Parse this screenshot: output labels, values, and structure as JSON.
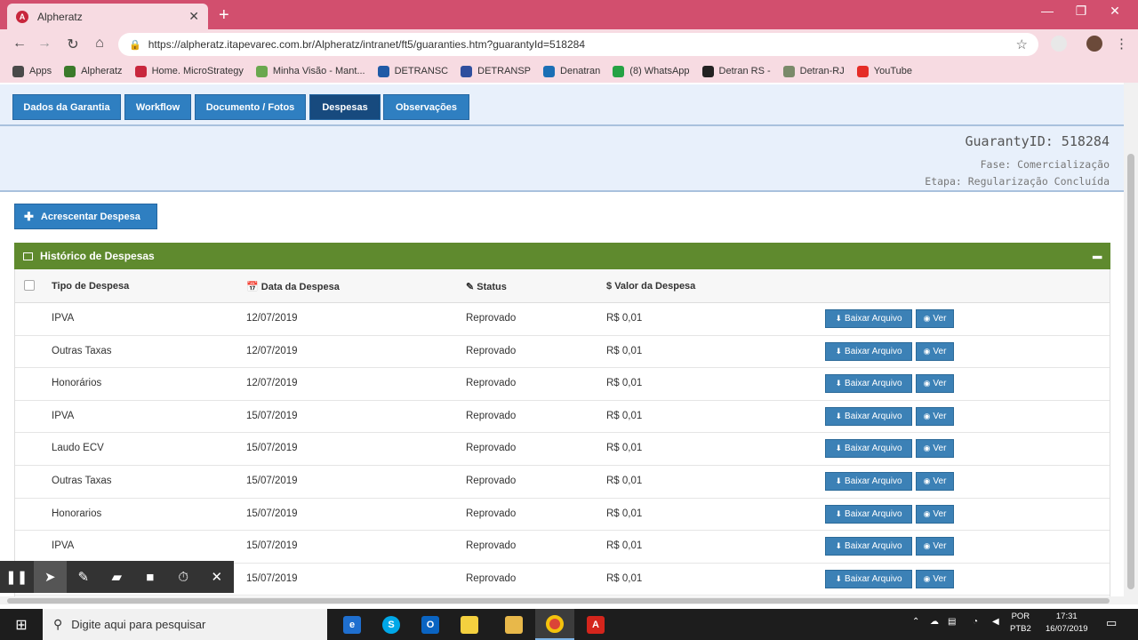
{
  "browser": {
    "tab_title": "Alpheratz",
    "url": "https://alpheratz.itapevarec.com.br/Alpheratz/intranet/ft5/guaranties.htm?guarantyId=518284",
    "bookmarks": [
      {
        "label": "Apps",
        "color": "#4a4a4a"
      },
      {
        "label": "Alpheratz",
        "color": "#3b7a2a"
      },
      {
        "label": "Home. MicroStrategy",
        "color": "#c8273d"
      },
      {
        "label": "Minha Visão - Mant...",
        "color": "#6aa84f"
      },
      {
        "label": "DETRANSC",
        "color": "#1f5aa6"
      },
      {
        "label": "DETRANSP",
        "color": "#2f4f9e"
      },
      {
        "label": "Denatran",
        "color": "#1b6fb5"
      },
      {
        "label": "(8) WhatsApp",
        "color": "#25a244"
      },
      {
        "label": "Detran RS -",
        "color": "#222222"
      },
      {
        "label": "Detran-RJ",
        "color": "#7a8a6a"
      },
      {
        "label": "YouTube",
        "color": "#e52d27"
      }
    ]
  },
  "page_tabs": [
    {
      "label": "Dados da Garantia",
      "active": false
    },
    {
      "label": "Workflow",
      "active": false
    },
    {
      "label": "Documento / Fotos",
      "active": false
    },
    {
      "label": "Despesas",
      "active": true
    },
    {
      "label": "Observações",
      "active": false
    }
  ],
  "info": {
    "guaranty": "GuarantyID: 518284",
    "fase": "Fase: Comercialização",
    "etapa": "Etapa: Regularização Concluída"
  },
  "add_button": "Acrescentar Despesa",
  "panel_title": "Histórico de Despesas",
  "table": {
    "headers": [
      "Tipo de Despesa",
      "Data da Despesa",
      "Status",
      "Valor da Despesa"
    ],
    "download_label": "Baixar Arquivo",
    "view_label": "Ver",
    "rows": [
      {
        "tipo": "IPVA",
        "data": "12/07/2019",
        "status": "Reprovado",
        "valor": "R$ 0,01"
      },
      {
        "tipo": "Outras Taxas",
        "data": "12/07/2019",
        "status": "Reprovado",
        "valor": "R$ 0,01"
      },
      {
        "tipo": "Honorários",
        "data": "12/07/2019",
        "status": "Reprovado",
        "valor": "R$ 0,01"
      },
      {
        "tipo": "IPVA",
        "data": "15/07/2019",
        "status": "Reprovado",
        "valor": "R$ 0,01"
      },
      {
        "tipo": "Laudo ECV",
        "data": "15/07/2019",
        "status": "Reprovado",
        "valor": "R$ 0,01"
      },
      {
        "tipo": "Outras Taxas",
        "data": "15/07/2019",
        "status": "Reprovado",
        "valor": "R$ 0,01"
      },
      {
        "tipo": "Honorarios",
        "data": "15/07/2019",
        "status": "Reprovado",
        "valor": "R$ 0,01"
      },
      {
        "tipo": "IPVA",
        "data": "15/07/2019",
        "status": "Reprovado",
        "valor": "R$ 0,01"
      },
      {
        "tipo": "",
        "data": "15/07/2019",
        "status": "Reprovado",
        "valor": "R$ 0,01"
      }
    ]
  },
  "taskbar": {
    "search_placeholder": "Digite aqui para pesquisar",
    "lang_line1": "POR",
    "lang_line2": "PTB2",
    "time": "17:31",
    "date": "16/07/2019"
  }
}
